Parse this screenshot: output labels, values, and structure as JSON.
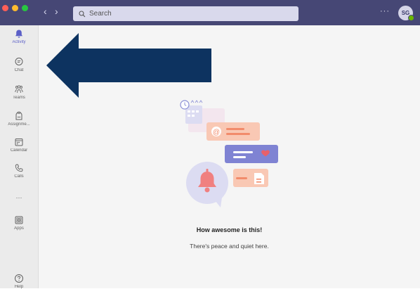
{
  "titlebar": {
    "search_placeholder": "Search",
    "more_label": "···",
    "avatar_initials": "SG"
  },
  "rail": {
    "items": [
      {
        "label": "Activity",
        "icon": "bell-icon",
        "active": true
      },
      {
        "label": "Chat",
        "icon": "chat-icon"
      },
      {
        "label": "Teams",
        "icon": "teams-icon"
      },
      {
        "label": "Assignme...",
        "icon": "assignments-icon"
      },
      {
        "label": "Calendar",
        "icon": "calendar-icon"
      },
      {
        "label": "Calls",
        "icon": "phone-icon"
      },
      {
        "label": "···",
        "icon": "more-apps-icon"
      },
      {
        "label": "Apps",
        "icon": "apps-icon"
      },
      {
        "label": "Help",
        "icon": "help-icon"
      }
    ]
  },
  "main": {
    "empty_title": "How awesome is this!",
    "empty_subtitle": "There's peace and quiet here."
  },
  "colors": {
    "titlebar": "#464775",
    "accent": "#5b5fc7",
    "arrow": "#0d3360"
  }
}
